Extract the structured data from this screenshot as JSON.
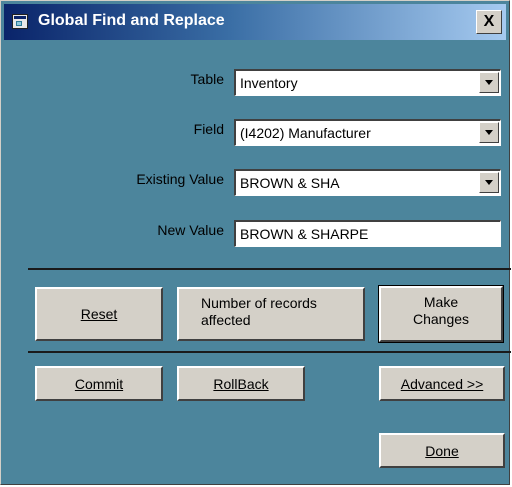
{
  "window": {
    "title": "Global Find and Replace",
    "close_glyph": "X",
    "title_icon": "form-window-icon",
    "colors": {
      "body": "#4c859c",
      "title_start": "#0a246a",
      "title_end": "#a6caf0",
      "button_face": "#d4d0c8"
    }
  },
  "form": {
    "table": {
      "label": "Table",
      "value": "Inventory"
    },
    "field": {
      "label": "Field",
      "value": "(I4202)   Manufacturer"
    },
    "existing": {
      "label": "Existing Value",
      "value": "BROWN & SHA"
    },
    "new_value": {
      "label": "New Value",
      "value": "BROWN & SHARPE"
    }
  },
  "buttons": {
    "reset": "Reset",
    "count_line1": "Number of records",
    "count_line2": "affected",
    "make_line1": "Make",
    "make_line2": "Changes",
    "commit": "Commit",
    "rollback": "RollBack",
    "advanced": "Advanced >>",
    "done": "Done"
  }
}
